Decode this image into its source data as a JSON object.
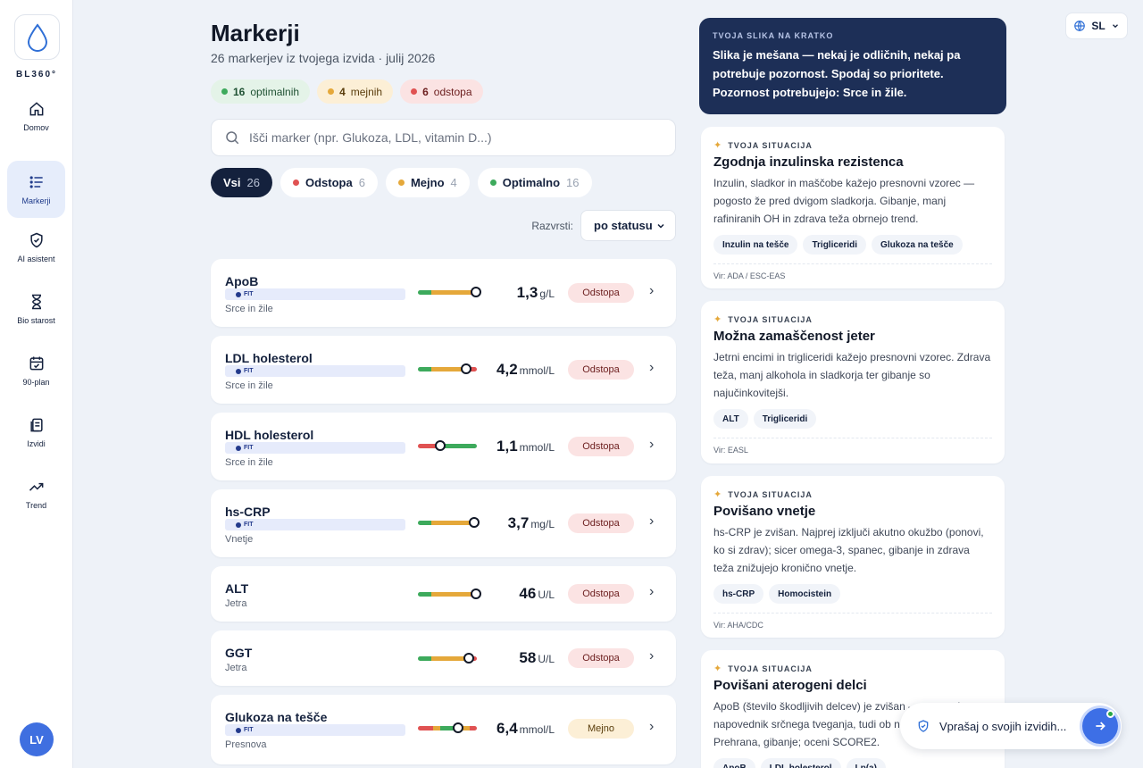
{
  "brand": {
    "name": "BL360°"
  },
  "nav": [
    {
      "label": "Domov",
      "icon": "home-icon"
    },
    {
      "label": "Markerji",
      "icon": "list-icon",
      "active": true
    },
    {
      "label": "AI asistent",
      "icon": "shield-check-icon"
    },
    {
      "label": "Bio starost",
      "icon": "hourglass-icon"
    },
    {
      "label": "90-plan",
      "icon": "calendar-check-icon"
    },
    {
      "label": "Izvidi",
      "icon": "documents-icon"
    },
    {
      "label": "Trend",
      "icon": "trend-up-icon"
    }
  ],
  "user": {
    "initials": "LV"
  },
  "header": {
    "title": "Markerji",
    "subtitle": "26 markerjev iz tvojega izvida · julij 2026",
    "pills": [
      {
        "count": "16",
        "label": "optimalnih",
        "color": "#3daa5c"
      },
      {
        "count": "4",
        "label": "mejnih",
        "color": "#e5a83a"
      },
      {
        "count": "6",
        "label": "odstopa",
        "color": "#e05252"
      }
    ]
  },
  "search": {
    "placeholder": "Išči marker (npr. Glukoza, LDL, vitamin D...)",
    "value": ""
  },
  "filters": [
    {
      "label": "Vsi",
      "count": "26",
      "active": true
    },
    {
      "label": "Odstopa",
      "count": "6",
      "color": "#e05252"
    },
    {
      "label": "Mejno",
      "count": "4",
      "color": "#e5a83a"
    },
    {
      "label": "Optimalno",
      "count": "16",
      "color": "#3daa5c"
    }
  ],
  "sort": {
    "label": "Razvrsti:",
    "value": "po statusu"
  },
  "markers": [
    {
      "name": "ApoB",
      "fit": "FIT",
      "category": "Srce in žile",
      "value": "1,3",
      "unit": "g/L",
      "status": "Odstopa",
      "statusKind": "red",
      "pos": 0.98,
      "scale": "gar"
    },
    {
      "name": "LDL holesterol",
      "fit": "FIT",
      "category": "Srce in žile",
      "value": "4,2",
      "unit": "mmol/L",
      "status": "Odstopa",
      "statusKind": "red",
      "pos": 0.82,
      "scale": "gar"
    },
    {
      "name": "HDL holesterol",
      "fit": "FIT",
      "category": "Srce in žile",
      "value": "1,1",
      "unit": "mmol/L",
      "status": "Odstopa",
      "statusKind": "red",
      "pos": 0.38,
      "scale": "rag"
    },
    {
      "name": "hs-CRP",
      "fit": "FIT",
      "category": "Vnetje",
      "value": "3,7",
      "unit": "mg/L",
      "status": "Odstopa",
      "statusKind": "red",
      "pos": 0.96,
      "scale": "gar"
    },
    {
      "name": "ALT",
      "category": "Jetra",
      "value": "46",
      "unit": "U/L",
      "status": "Odstopa",
      "statusKind": "red",
      "pos": 0.98,
      "scale": "gar"
    },
    {
      "name": "GGT",
      "category": "Jetra",
      "value": "58",
      "unit": "U/L",
      "status": "Odstopa",
      "statusKind": "red",
      "pos": 0.86,
      "scale": "gar"
    },
    {
      "name": "Glukoza na tešče",
      "fit": "FIT",
      "category": "Presnova",
      "value": "6,4",
      "unit": "mmol/L",
      "status": "Mejno",
      "statusKind": "amber",
      "pos": 0.68,
      "scale": "ragar"
    }
  ],
  "summary": {
    "label": "TVOJA SLIKA NA KRATKO",
    "text": "Slika je mešana — nekaj je odličnih, nekaj pa potrebuje pozornost. Spodaj so prioritete. Pozornost potrebujejo: Srce in žile."
  },
  "situations": [
    {
      "kicker": "TVOJA SITUACIJA",
      "title": "Zgodnja inzulinska rezistenca",
      "desc": "Inzulin, sladkor in maščobe kažejo presnovni vzorec — pogosto že pred dvigom sladkorja. Gibanje, manj rafiniranih OH in zdrava teža obrnejo trend.",
      "tags": [
        "Inzulin na tešče",
        "Trigliceridi",
        "Glukoza na tešče"
      ],
      "source": "Vir: ADA / ESC-EAS"
    },
    {
      "kicker": "TVOJA SITUACIJA",
      "title": "Možna zamaščenost jeter",
      "desc": "Jetrni encimi in trigliceridi kažejo presnovni vzorec. Zdrava teža, manj alkohola in sladkorja ter gibanje so najučinkovitejši.",
      "tags": [
        "ALT",
        "Trigliceridi"
      ],
      "source": "Vir: EASL"
    },
    {
      "kicker": "TVOJA SITUACIJA",
      "title": "Povišano vnetje",
      "desc": "hs-CRP je zvišan. Najprej izključi akutno okužbo (ponovi, ko si zdrav); sicer omega-3, spanec, gibanje in zdrava teža znižujejo kronično vnetje.",
      "tags": [
        "hs-CRP",
        "Homocistein"
      ],
      "source": "Vir: AHA/CDC"
    },
    {
      "kicker": "TVOJA SITUACIJA",
      "title": "Povišani aterogeni delci",
      "desc": "ApoB (število škodljivih delcev) je zvišan — pomemben napovednik srčnega tveganja, tudi ob normalnem LDL. Prehrana, gibanje; oceni SCORE2.",
      "tags": [
        "ApoB",
        "LDL holesterol",
        "Lp(a)"
      ],
      "source": ""
    }
  ],
  "lang": {
    "code": "SL"
  },
  "chat": {
    "placeholder": "Vprašaj o svojih izvidih..."
  },
  "colors": {
    "green": "#3daa5c",
    "amber": "#e5a83a",
    "red": "#e05252",
    "navy": "#1d2f57",
    "accent": "#3d6fe6"
  }
}
